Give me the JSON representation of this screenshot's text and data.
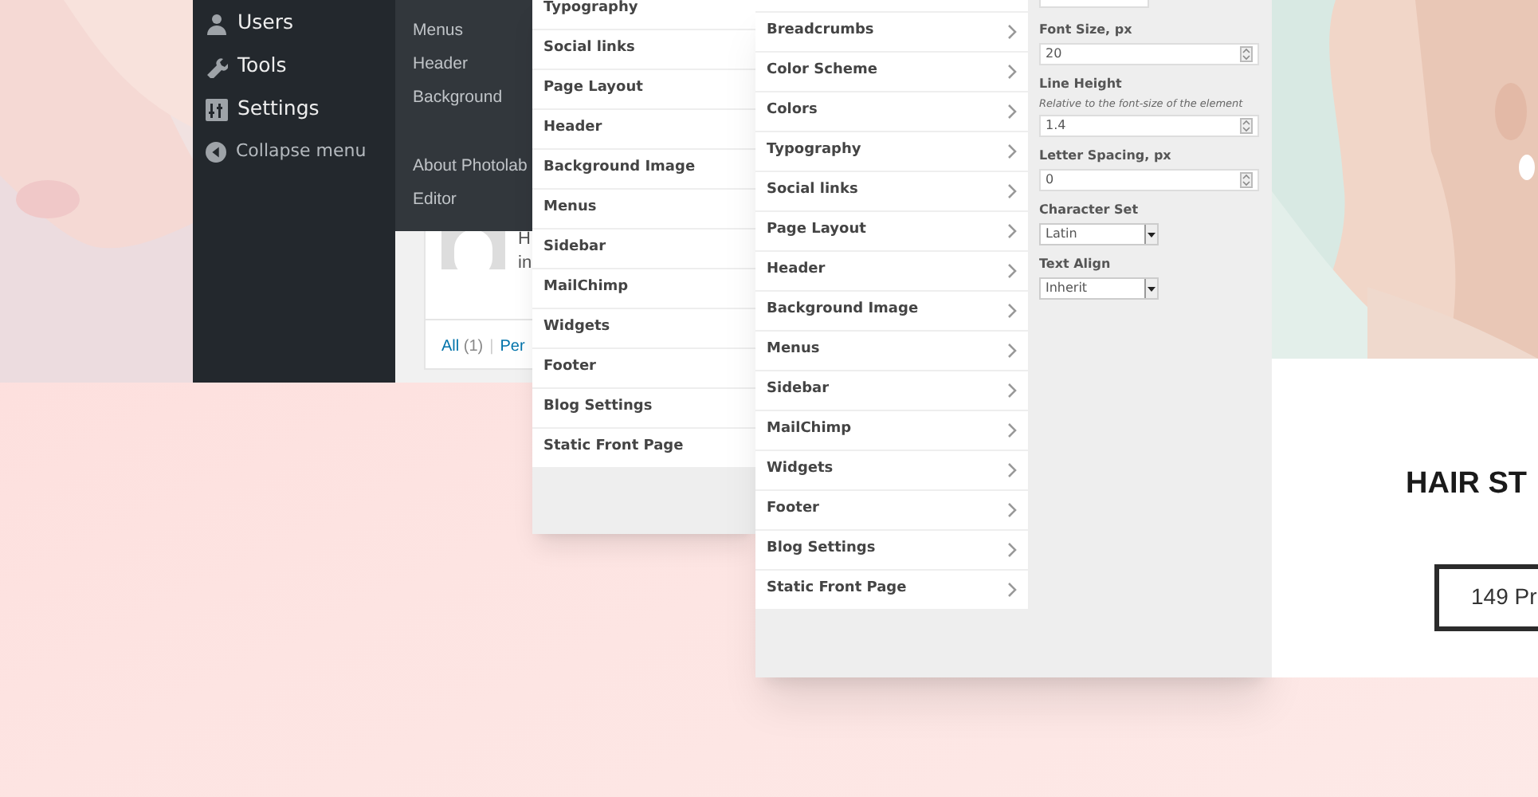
{
  "admin_menu": {
    "items": [
      {
        "label": "Users"
      },
      {
        "label": "Tools"
      },
      {
        "label": "Settings"
      },
      {
        "label": "Collapse menu"
      }
    ]
  },
  "submenu": {
    "items": [
      {
        "label": "Menus"
      },
      {
        "label": "Header"
      },
      {
        "label": "Background"
      },
      {
        "label": "About Photolab"
      },
      {
        "label": "Editor"
      }
    ]
  },
  "posts_card": {
    "title_fragment": "H",
    "excerpt_fragment": "in",
    "filter_label": "All",
    "filter_count": "(1)",
    "separator": "|",
    "cut_filter": "Per"
  },
  "customizer_back": {
    "sections": [
      "Typography",
      "Social links",
      "Page Layout",
      "Header",
      "Background Image",
      "Menus",
      "Sidebar",
      "MailChimp",
      "Widgets",
      "Footer",
      "Blog Settings",
      "Static Front Page"
    ]
  },
  "customizer_front": {
    "sections": [
      "Breadcrumbs",
      "Color Scheme",
      "Colors",
      "Typography",
      "Social links",
      "Page Layout",
      "Header",
      "Background Image",
      "Menus",
      "Sidebar",
      "MailChimp",
      "Widgets",
      "Footer",
      "Blog Settings",
      "Static Front Page"
    ],
    "controls": [
      {
        "kind": "number",
        "label": "Font Size, px",
        "value": "20"
      },
      {
        "kind": "number",
        "label": "Line Height",
        "hint": "Relative to the font-size of the element",
        "value": "1.4"
      },
      {
        "kind": "number",
        "label": "Letter Spacing, px",
        "value": "0"
      },
      {
        "kind": "select",
        "label": "Character Set",
        "value": "Latin"
      },
      {
        "kind": "select",
        "label": "Text Align",
        "value": "Inherit"
      }
    ]
  },
  "product_card": {
    "title": "HAIR ST",
    "button": "149 Pr"
  }
}
